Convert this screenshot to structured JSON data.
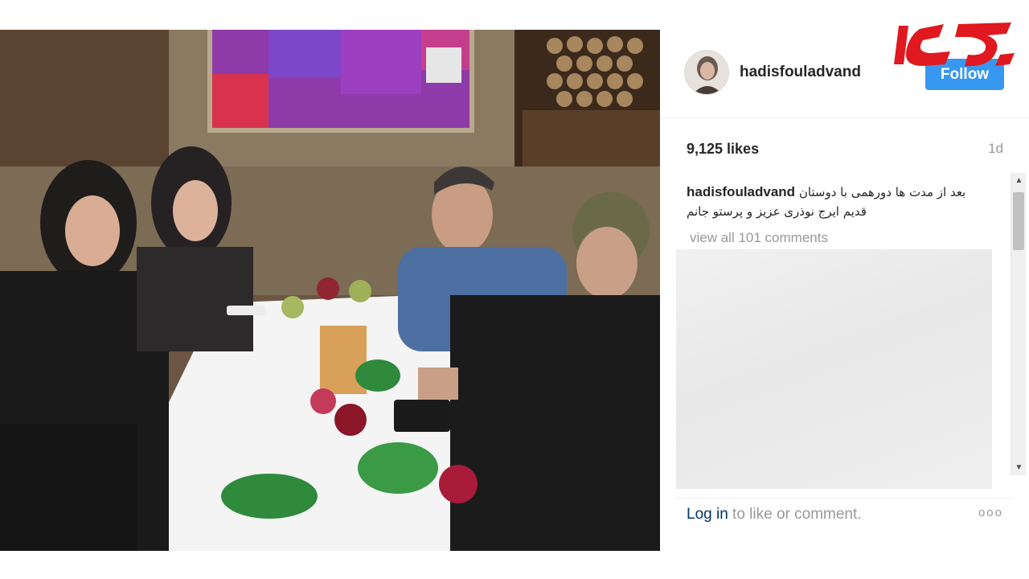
{
  "post": {
    "username": "hadisfouladvand",
    "follow_label": "Follow",
    "likes_text": "9,125 likes",
    "time_ago": "1d",
    "caption_user": "hadisfouladvand",
    "caption_text": "بعد از مدت ها دورهمی با دوستان قدیم ایرج نوذری عزیز و پرستو جانم",
    "view_all_comments": "view all 101 comments",
    "login_link": "Log in",
    "login_suffix": " to like or comment.",
    "more_icon": "ooo"
  },
  "icons": {
    "scroll_up": "▲",
    "scroll_down": "▼"
  },
  "colors": {
    "follow_button": "#3897f0",
    "logo_red": "#e0181f",
    "link": "#003569"
  }
}
